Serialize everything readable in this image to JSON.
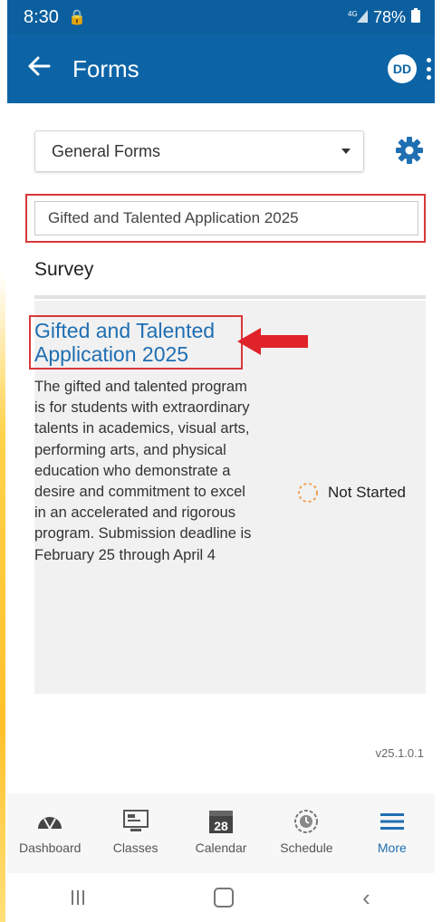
{
  "status_bar": {
    "time": "8:30",
    "battery": "78%"
  },
  "app_bar": {
    "title": "Forms",
    "avatar_initials": "DD"
  },
  "filter": {
    "selected": "General Forms"
  },
  "search": {
    "value": "Gifted and Talented Application 2025"
  },
  "section_title": "Survey",
  "form_card": {
    "title": "Gifted and Talented Application 2025",
    "description": "The gifted and talented program is for students with extraordinary talents in academics, visual arts, performing arts, and physical education who demonstrate a desire and commitment to excel in an accelerated and rigorous program. Submission deadline is February 25 through April 4",
    "status": "Not Started"
  },
  "version": "v25.1.0.1",
  "bottom_nav": {
    "items": [
      {
        "label": "Dashboard",
        "icon": "dashboard-icon"
      },
      {
        "label": "Classes",
        "icon": "classes-icon"
      },
      {
        "label": "Calendar",
        "icon": "calendar-icon",
        "badge": "28"
      },
      {
        "label": "Schedule",
        "icon": "schedule-icon"
      },
      {
        "label": "More",
        "icon": "menu-icon"
      }
    ]
  },
  "colors": {
    "app_bar": "#0c64a6",
    "link": "#1f6fb2",
    "highlight": "#d9373b",
    "status_ring": "#f0a050"
  }
}
